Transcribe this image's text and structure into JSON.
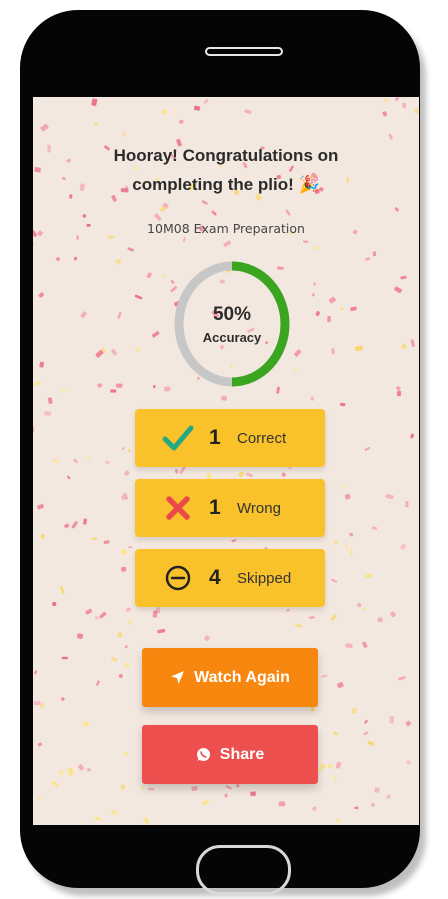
{
  "header": {
    "title_line1": "Hooray! Congratulations on",
    "title_line2": "completing the plio! 🎉",
    "subtitle": "10M08 Exam Preparation"
  },
  "accuracy": {
    "value": "50%",
    "label": "Accuracy",
    "fraction": 0.5
  },
  "stats": [
    {
      "count": "1",
      "label": "Correct",
      "icon": "check-icon"
    },
    {
      "count": "1",
      "label": "Wrong",
      "icon": "cross-icon"
    },
    {
      "count": "4",
      "label": "Skipped",
      "icon": "skip-icon"
    }
  ],
  "buttons": {
    "watch_again": "Watch Again",
    "share": "Share"
  },
  "colors": {
    "background": "#f3e8e0",
    "progress": "#3aa51e",
    "progress_track": "#c7c7c7",
    "stat_card": "#f9c22b",
    "watch_button": "#f7870f",
    "share_button": "#ed4e4e",
    "check": "#27a884",
    "cross": "#ea4a4a"
  }
}
